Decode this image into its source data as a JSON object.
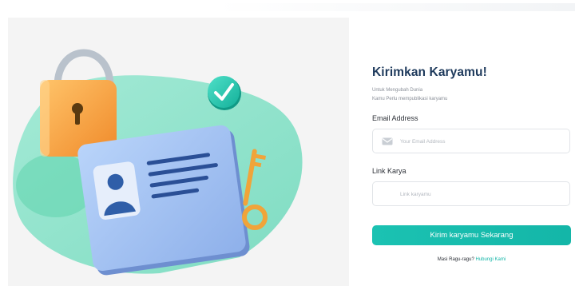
{
  "form": {
    "title": "Kirimkan Karyamu!",
    "subtitle_line1": "Untuk Mengubah Dunia",
    "subtitle_line2": "Kamu Perlu mempublikasi karyamu",
    "email": {
      "label": "Email Address",
      "placeholder": "Your Email Address",
      "value": "",
      "icon": "envelope-icon"
    },
    "link": {
      "label": "Link Karya",
      "placeholder": "Link karyamu",
      "value": ""
    },
    "submit_label": "Kirim karyamu Sekarang",
    "footer_text": "Masi Ragu-ragu?",
    "footer_link": "Hubungi Kami"
  },
  "illustration": {
    "icons": [
      "padlock-icon",
      "check-badge-icon",
      "id-card-icon",
      "key-icon"
    ]
  },
  "colors": {
    "accent": "#14b6a8",
    "title": "#1e3a5c",
    "blob": "#8fe3cd",
    "card": "#a9c6f2"
  }
}
